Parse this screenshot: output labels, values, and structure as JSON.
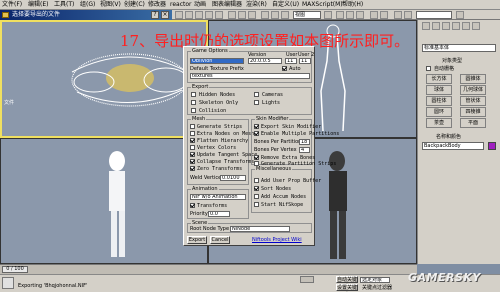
{
  "menubar": {
    "items": [
      "文件(F)",
      "编辑(E)",
      "工具(T)",
      "组(G)",
      "视图(V)",
      "创建(C)",
      "修改器",
      "reactor",
      "动画",
      "图表编辑器",
      "渲染(R)",
      "自定义(U)",
      "MAXScript(M)",
      "帮助(H)"
    ]
  },
  "dialog_title": "选择要导出的文件",
  "toolbar": {
    "view_select": "视图",
    "right_select": ""
  },
  "caption": "17、导出时仍的选项设置如本图所示即可。",
  "viewports": {
    "top_left_label": "",
    "left_side_text": "文件"
  },
  "right_panel": {
    "dropdown": "标准基本体",
    "section_title": "对象类型",
    "auto_grid": "自动栅格",
    "buttons": [
      "长方体",
      "圆锥体",
      "球体",
      "几何球体",
      "圆柱体",
      "管状体",
      "圆环",
      "四棱锥",
      "茶壶",
      "平面"
    ],
    "name_section": "名称和颜色",
    "object_name": "BackpackBody"
  },
  "export_dialog": {
    "game_options_title": "Game Options",
    "version_label": "Version",
    "user_label": "User",
    "user2_label": "User 2",
    "game_select": "Oblivion",
    "version_value": "20.0.0.5",
    "user_value": "11",
    "user2_value": "11",
    "texture_prefix_label": "Default Texture Prefix",
    "auto_label": "Auto",
    "texture_prefix_value": "textures",
    "export_title": "Export",
    "hidden_nodes": "Hidden Nodes",
    "cameras": "Cameras",
    "skeleton_only": "Skeleton Only",
    "lights": "Lights",
    "collision": "Collision",
    "mesh_title": "Mesh",
    "generate_strips": "Generate Strips",
    "extra_nodes": "Extra Nodes on Mesh",
    "flatten_hierarchy": "Flatten Hierarchy",
    "vertex_colors": "Vertex Colors",
    "update_tangent": "Update Tangent Space",
    "collapse_transforms": "Collapse Transforms",
    "zero_transforms": "Zero Transforms",
    "weld_vertices_label": "Weld Vertices",
    "weld_vertices_value": "0.0100",
    "skin_title": "Skin Modifier",
    "export_skin": "Export Skin Modifier",
    "enable_multiple": "Enable Multiple Partitions",
    "bones_per_partition_label": "Bones Per Partition",
    "bones_per_partition_value": "18",
    "bones_per_vertex_label": "Bones Per Vertex",
    "bones_per_vertex_value": "4",
    "remove_extra_bones": "Remove Extra Bones",
    "generate_partition": "Generate Partition Strips",
    "animation_title": "Animation",
    "animation_select": "NIF w/o Animation",
    "transforms": "Transforms",
    "priority_label": "Priority",
    "priority_value": "0.0",
    "misc_title": "Miscellaneous",
    "add_user_prop": "Add User Prop Buffer",
    "sort_nodes": "Sort Nodes",
    "add_accum_nodes": "Add Accum Nodes",
    "start_nifskope": "Start NifSkope",
    "scene_title": "Scene",
    "root_node_type_label": "Root Node Type",
    "root_node_type_value": "NiNode",
    "export_button": "Export",
    "cancel_button": "Cancel",
    "footer_text": "Niftools Project Wiki"
  },
  "timeline": {
    "frame_label": "0 / 100"
  },
  "statusbar": {
    "exporting_text": "Exporting 'Bhqjohonnal.NIF'",
    "right_label1": "自动关键点",
    "right_select": "选定对象",
    "right_label2": "设置关键点",
    "right_label3": "关键点过滤器",
    "watermark": "GAMERSKY"
  },
  "colors": {
    "caption": "#ff2020",
    "title_gradient_start": "#0a246a",
    "viewport": "#8b98ab"
  }
}
